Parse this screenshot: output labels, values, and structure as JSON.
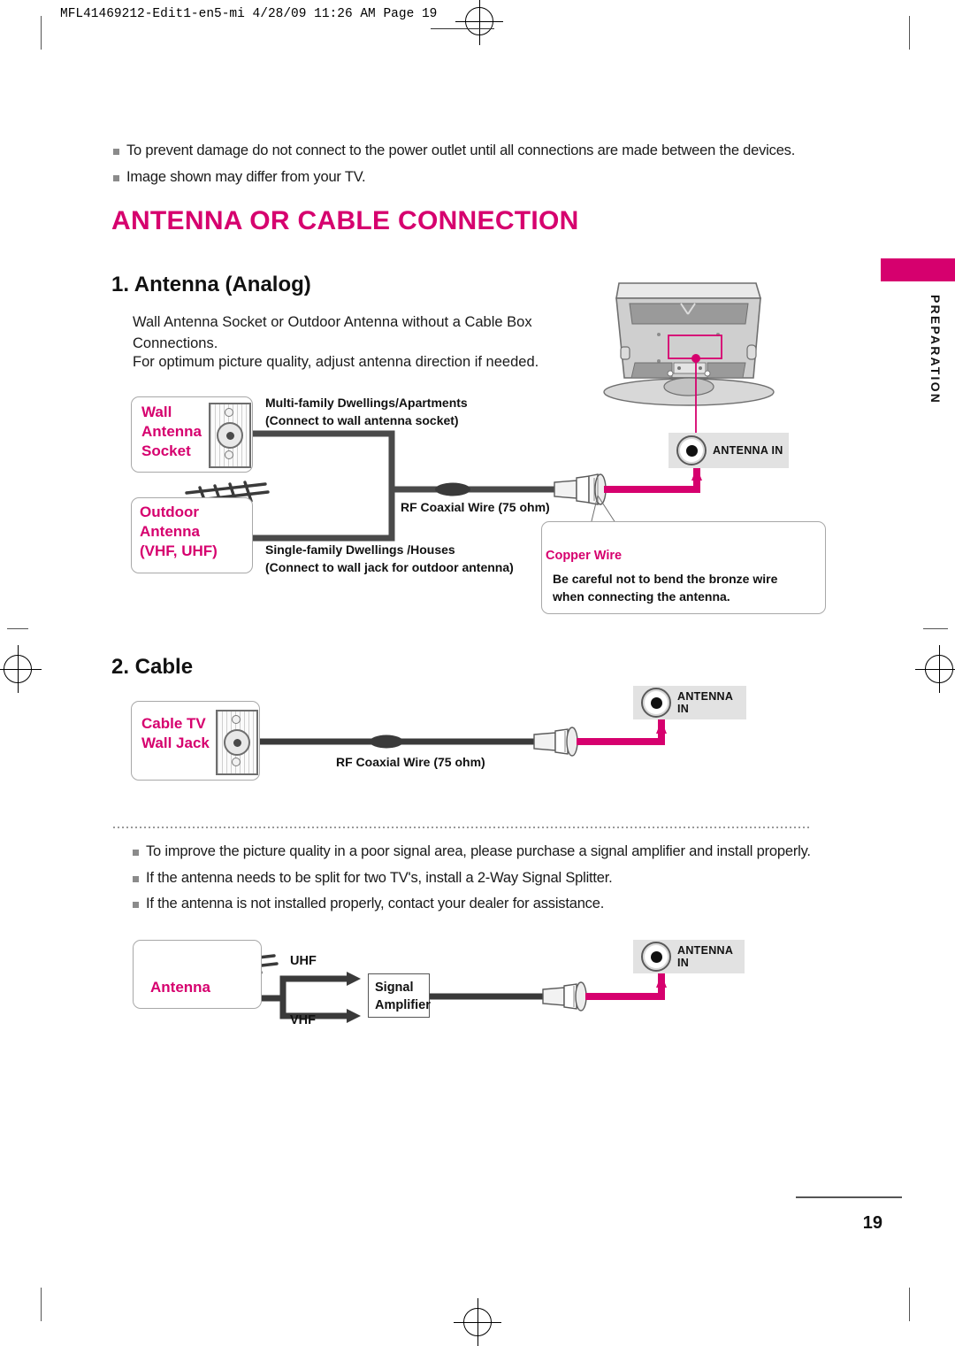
{
  "print_slug": "MFL41469212-Edit1-en5-mi  4/28/09 11:26 AM  Page 19",
  "top_notes": [
    "To prevent damage do not connect to the power outlet until all connections are made between the devices.",
    "Image shown may differ from your TV."
  ],
  "heading": "ANTENNA OR CABLE CONNECTION",
  "sidebar": {
    "label": "PREPARATION",
    "accent_color": "#d6006e"
  },
  "section1": {
    "title": "1. Antenna (Analog)",
    "paragraph1": "Wall Antenna Socket or Outdoor Antenna without a Cable Box Connections.",
    "paragraph2": "For optimum picture quality, adjust antenna direction if needed.",
    "wall_socket_label": "Wall\nAntenna\nSocket",
    "wall_socket_label_lines": [
      "Wall",
      "Antenna",
      "Socket"
    ],
    "outdoor_label_lines": [
      "Outdoor",
      "Antenna",
      "(VHF, UHF)"
    ],
    "multi_family_lines": [
      "Multi-family Dwellings/Apartments",
      "(Connect to wall antenna socket)"
    ],
    "single_family_lines": [
      "Single-family Dwellings /Houses",
      "(Connect to wall jack for outdoor antenna)"
    ],
    "coax_label": "RF Coaxial Wire (75 ohm)",
    "antenna_in_label": "ANTENNA IN",
    "copper_wire_label": "Copper Wire",
    "warning_lines": [
      "Be careful not to bend the bronze wire",
      "when connecting the antenna."
    ]
  },
  "section2": {
    "title": "2. Cable",
    "wall_jack_lines": [
      "Cable TV",
      "Wall Jack"
    ],
    "coax_label": "RF Coaxial Wire (75 ohm)",
    "antenna_in_label": "ANTENNA IN"
  },
  "bottom_notes": [
    "To improve the picture quality in a poor signal area, please purchase a signal amplifier and install properly.",
    "If the antenna needs to be split for two TV's, install a 2-Way Signal Splitter.",
    "If the antenna is not installed properly, contact your dealer for assistance."
  ],
  "section3": {
    "antenna_label": "Antenna",
    "uhf_label": "UHF",
    "vhf_label": "VHF",
    "amplifier_lines": [
      "Signal",
      "Amplifier"
    ],
    "antenna_in_label": "ANTENNA IN"
  },
  "page_number": "19"
}
